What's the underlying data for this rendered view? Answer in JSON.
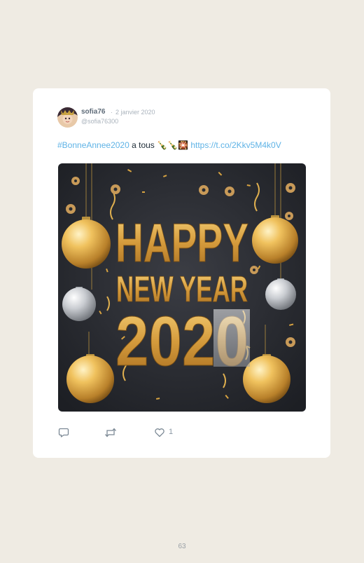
{
  "tweet": {
    "display_name": "sofia76",
    "separator": "·",
    "date": "2 janvier 2020",
    "handle": "@sofia76300",
    "hashtag": "#BonneAnnee2020",
    "text": " a tous ",
    "emojis": "🍾🍾🎇",
    "link": "https://t.co/2Kkv5M4k0V",
    "image": {
      "line1": "HAPPY",
      "line2": "NEW YEAR",
      "line3": "2020"
    }
  },
  "actions": {
    "reply_icon": "reply-icon",
    "retweet_icon": "retweet-icon",
    "like_icon": "heart-icon",
    "like_count": "1"
  },
  "footer": {
    "page_number": "63"
  },
  "colors": {
    "page_background": "#efebe3",
    "card": "#ffffff",
    "link": "#5fb3e6",
    "gold": "#d9a441",
    "silver": "#c8cbd0",
    "image_background": "#25272d"
  }
}
